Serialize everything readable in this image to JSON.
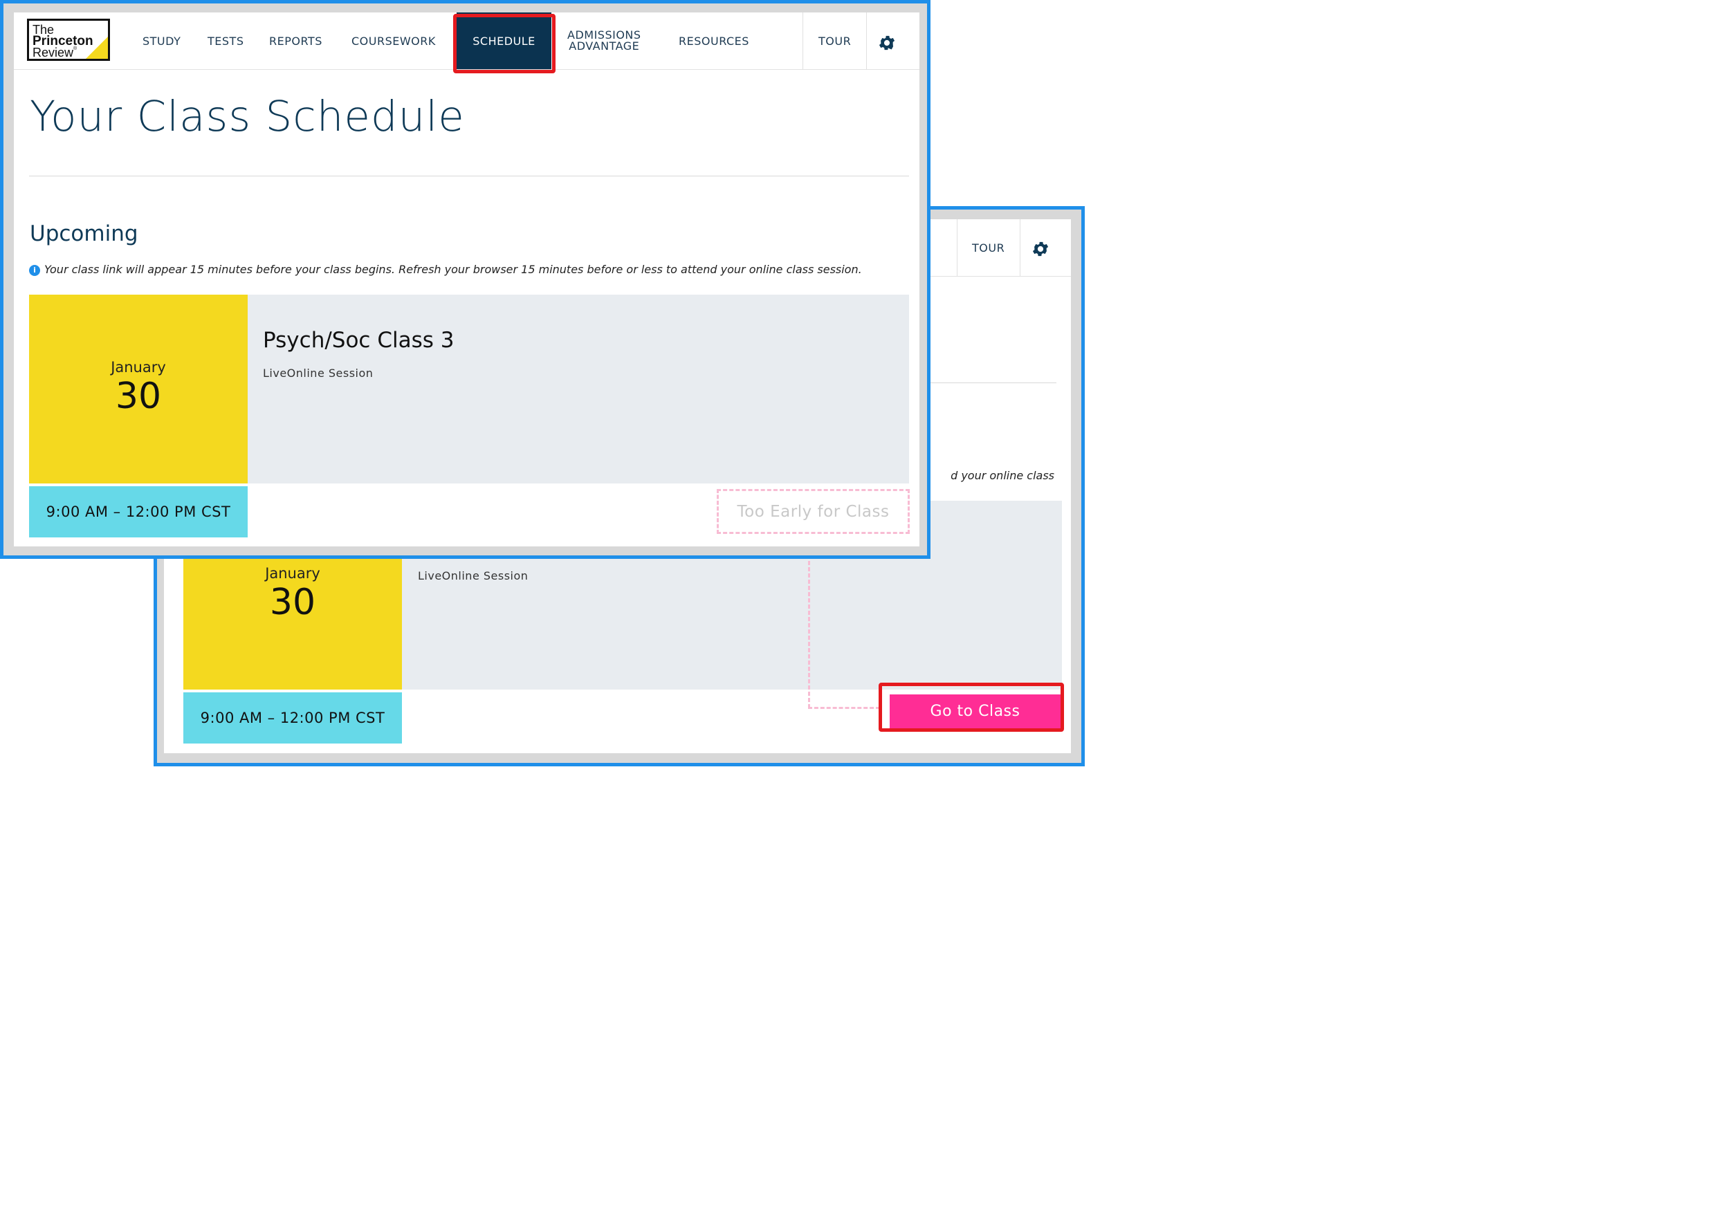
{
  "logo": {
    "line1": "The",
    "line2": "Princeton",
    "line3": "Review",
    "mark": "®"
  },
  "nav": {
    "items": [
      "STUDY",
      "TESTS",
      "REPORTS",
      "COURSEWORK",
      "SCHEDULE"
    ],
    "admissions_line1": "ADMISSIONS",
    "admissions_line2": "ADVANTAGE",
    "resources": "RESOURCES",
    "tour": "TOUR",
    "settings_icon": "gear-icon"
  },
  "page": {
    "title": "Your Class Schedule",
    "section_title": "Upcoming",
    "info_icon": "info-icon",
    "note": "Your class link will appear 15 minutes before your class begins. Refresh your browser 15 minutes before or less to attend your online class session.",
    "note_partial": "d your online class"
  },
  "class": {
    "month": "January",
    "day": "30",
    "name": "Psych/Soc Class 3",
    "type": "LiveOnline Session",
    "time": "9:00 AM – 12:00 PM CST"
  },
  "buttons": {
    "too_early": "Too Early for Class",
    "go_to_class": "Go to Class"
  },
  "colors": {
    "frame_border": "#1f8fe9",
    "nav_active": "#0b3350",
    "highlight": "#e51a1f",
    "date_yellow": "#f4d91f",
    "time_cyan": "#66d9e8",
    "go_pink": "#ff2d95"
  }
}
